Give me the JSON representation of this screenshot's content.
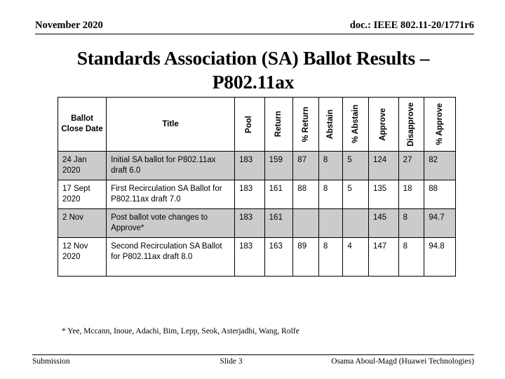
{
  "header": {
    "date": "November 2020",
    "doc_id": "doc.: IEEE 802.11-20/1771r6"
  },
  "title": {
    "line1": "Standards Association (SA) Ballot Results –",
    "line2": "P802.11ax"
  },
  "table": {
    "columns": [
      {
        "label": "Ballot Close Date",
        "rotated": false
      },
      {
        "label": "Title",
        "rotated": false
      },
      {
        "label": "Pool",
        "rotated": true
      },
      {
        "label": "Return",
        "rotated": true
      },
      {
        "label": "% Return",
        "rotated": true
      },
      {
        "label": "Abstain",
        "rotated": true
      },
      {
        "label": "% Abstain",
        "rotated": true
      },
      {
        "label": "Approve",
        "rotated": true
      },
      {
        "label": "Disapprove",
        "rotated": true
      },
      {
        "label": "% Approve",
        "rotated": true
      }
    ],
    "rows": [
      {
        "shaded": true,
        "date": "24 Jan 2020",
        "title": "Initial SA ballot for P802.11ax draft 6.0",
        "pool": "183",
        "return": "159",
        "pct_return": "87",
        "abstain": "8",
        "pct_abstain": "5",
        "approve": "124",
        "disapprove": "27",
        "pct_approve": "82"
      },
      {
        "shaded": false,
        "date": "17 Sept 2020",
        "title": "First Recirculation SA  Ballot for P802.11ax draft 7.0",
        "pool": "183",
        "return": "161",
        "pct_return": "88",
        "abstain": "8",
        "pct_abstain": "5",
        "approve": "135",
        "disapprove": "18",
        "pct_approve": "88"
      },
      {
        "shaded": true,
        "date": "2 Nov",
        "title": "Post ballot vote changes to Approve*",
        "pool": "183",
        "return": "161",
        "pct_return": "",
        "abstain": "",
        "pct_abstain": "",
        "approve": "145",
        "disapprove": "8",
        "pct_approve": "94.7"
      },
      {
        "shaded": false,
        "date": "12 Nov 2020",
        "title": "Second Recirculation SA Ballot for P802.11ax draft 8.0",
        "pool": "183",
        "return": "163",
        "pct_return": "89",
        "abstain": "8",
        "pct_abstain": "4",
        "approve": "147",
        "disapprove": "8",
        "pct_approve": "94.8"
      }
    ]
  },
  "footnote": "* Yee, Mccann, Inoue, Adachi, Bim, Lepp, Seok, Asterjadhi, Wang, Rolfe",
  "footer": {
    "left": "Submission",
    "center": "Slide 3",
    "right": "Osama Aboul-Magd (Huawei Technologies)"
  }
}
